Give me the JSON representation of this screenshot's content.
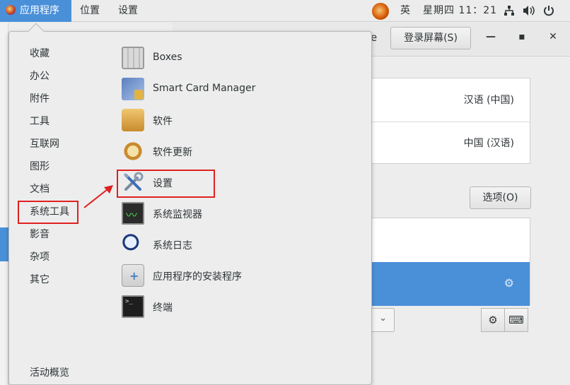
{
  "topbar": {
    "applications": "应用程序",
    "places": "位置",
    "settings": "设置",
    "input_method": "英",
    "clock": "星期四 11：21",
    "icons": [
      "network-icon",
      "volume-icon",
      "power-icon"
    ]
  },
  "background_window": {
    "title_partial": "e",
    "login_screen_button": "登录屏幕(S)",
    "language_value": "汉语 (中国)",
    "region_value": "中国 (汉语)",
    "options_button": "选项(O)"
  },
  "menu": {
    "categories": [
      "收藏",
      "办公",
      "附件",
      "工具",
      "互联网",
      "图形",
      "文档",
      "系统工具",
      "影音",
      "杂项",
      "其它"
    ],
    "overview": "活动概览",
    "apps": [
      {
        "label": "Boxes",
        "icon": "boxes-icon"
      },
      {
        "label": "Smart Card Manager",
        "icon": "smart-card-icon"
      },
      {
        "label": "软件",
        "icon": "software-icon"
      },
      {
        "label": "软件更新",
        "icon": "software-update-icon"
      },
      {
        "label": "设置",
        "icon": "settings-tools-icon"
      },
      {
        "label": "系统监视器",
        "icon": "system-monitor-icon"
      },
      {
        "label": "系统日志",
        "icon": "system-log-icon"
      },
      {
        "label": "应用程序的安装程序",
        "icon": "app-installer-icon"
      },
      {
        "label": "终端",
        "icon": "terminal-icon"
      }
    ]
  },
  "annotation_colors": {
    "highlight": "#e02020",
    "selection": "#4a90d9"
  }
}
